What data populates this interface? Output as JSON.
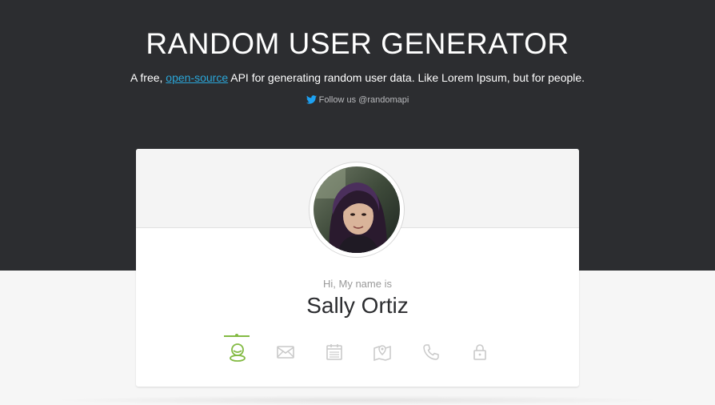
{
  "header": {
    "title": "RANDOM USER GENERATOR",
    "tagline_prefix": "A free, ",
    "tagline_link": "open-source",
    "tagline_suffix": " API for generating random user data. Like Lorem Ipsum, but for people.",
    "follow_text": "Follow us @randomapi",
    "follow_icon": "twitter-icon"
  },
  "card": {
    "greeting": "Hi, My name is",
    "name": "Sally Ortiz",
    "tabs": [
      {
        "icon": "user-icon",
        "active": true
      },
      {
        "icon": "envelope-icon",
        "active": false
      },
      {
        "icon": "calendar-icon",
        "active": false
      },
      {
        "icon": "map-icon",
        "active": false
      },
      {
        "icon": "phone-icon",
        "active": false
      },
      {
        "icon": "lock-icon",
        "active": false
      }
    ]
  },
  "colors": {
    "hero_bg": "#2c2d30",
    "link": "#2ba6d8",
    "accent_green": "#83ba43",
    "icon_gray": "#c9c9c9"
  }
}
